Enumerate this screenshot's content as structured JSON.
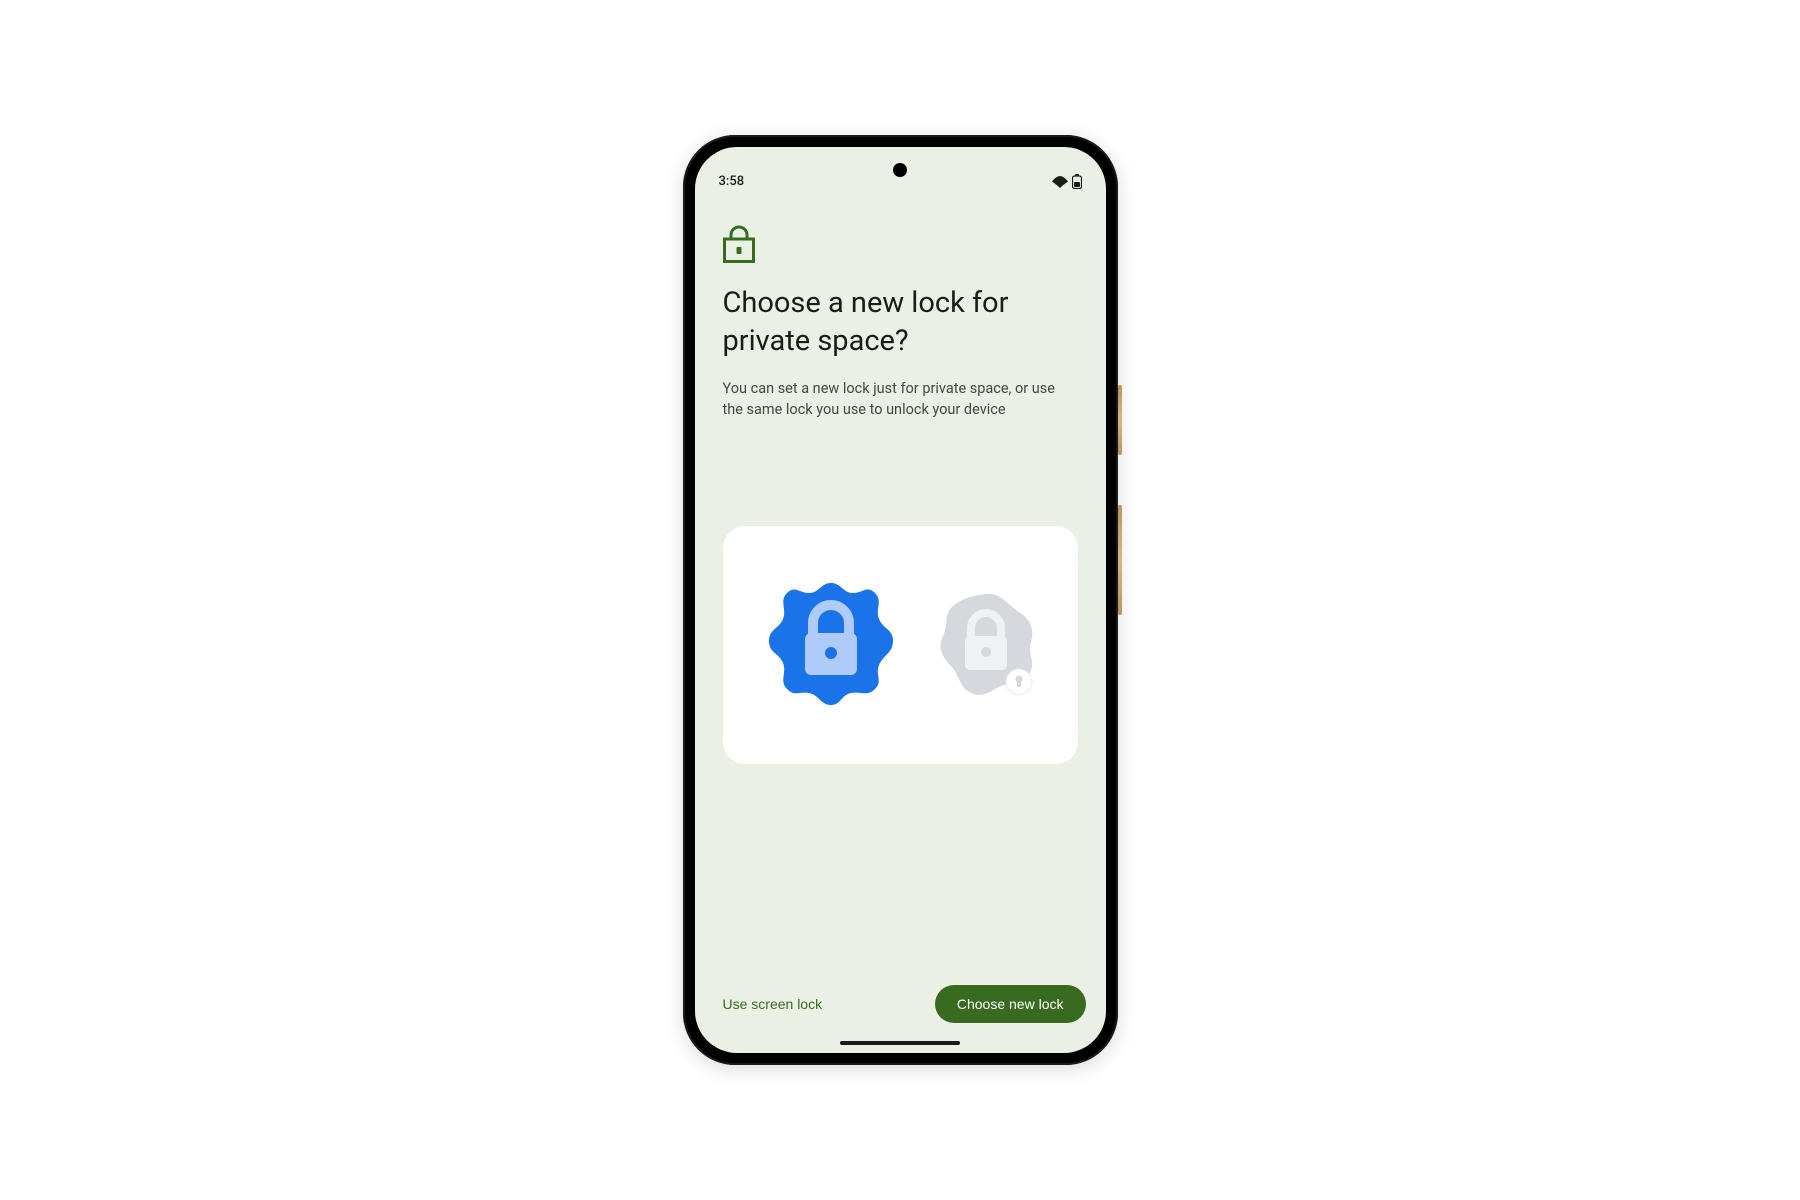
{
  "status": {
    "time": "3:58"
  },
  "header": {
    "title": "Choose a new lock for private space?",
    "subtitle": "You can set a new lock just for private space, or use the same lock you use to unlock your device"
  },
  "footer": {
    "secondary_label": "Use screen lock",
    "primary_label": "Choose new lock"
  },
  "colors": {
    "accent": "#386a20",
    "background": "#eaf0e3",
    "illustration_primary": "#1a73e8",
    "illustration_primary_light": "#aecbfa",
    "illustration_muted": "#bdc1c6"
  }
}
